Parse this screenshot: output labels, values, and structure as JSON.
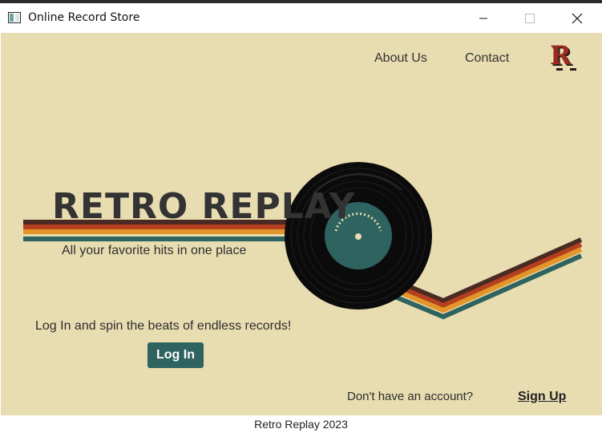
{
  "window": {
    "title": "Online Record Store",
    "icon": "app-window-icon",
    "controls": [
      "minimize-icon",
      "maximize-icon",
      "close-icon"
    ]
  },
  "nav": {
    "about_label": "About Us",
    "contact_label": "Contact",
    "logo_letter": "R"
  },
  "hero": {
    "brand_title": "RETRO REPLAY",
    "tagline": "All your favorite hits in one place",
    "promo_text": "Log In and spin the beats of endless records!",
    "login_label": "Log In"
  },
  "signup": {
    "prompt": "Don't have an account?",
    "link_label": "Sign Up"
  },
  "footer": {
    "text": "Retro Replay 2023"
  },
  "colors": {
    "background": "#e8ddb1",
    "stripe_dark": "#4a2a22",
    "stripe_red": "#b5401f",
    "stripe_orange": "#e2962a",
    "stripe_teal": "#2f6360",
    "record_label": "#2f6360",
    "button": "#2f6360"
  }
}
